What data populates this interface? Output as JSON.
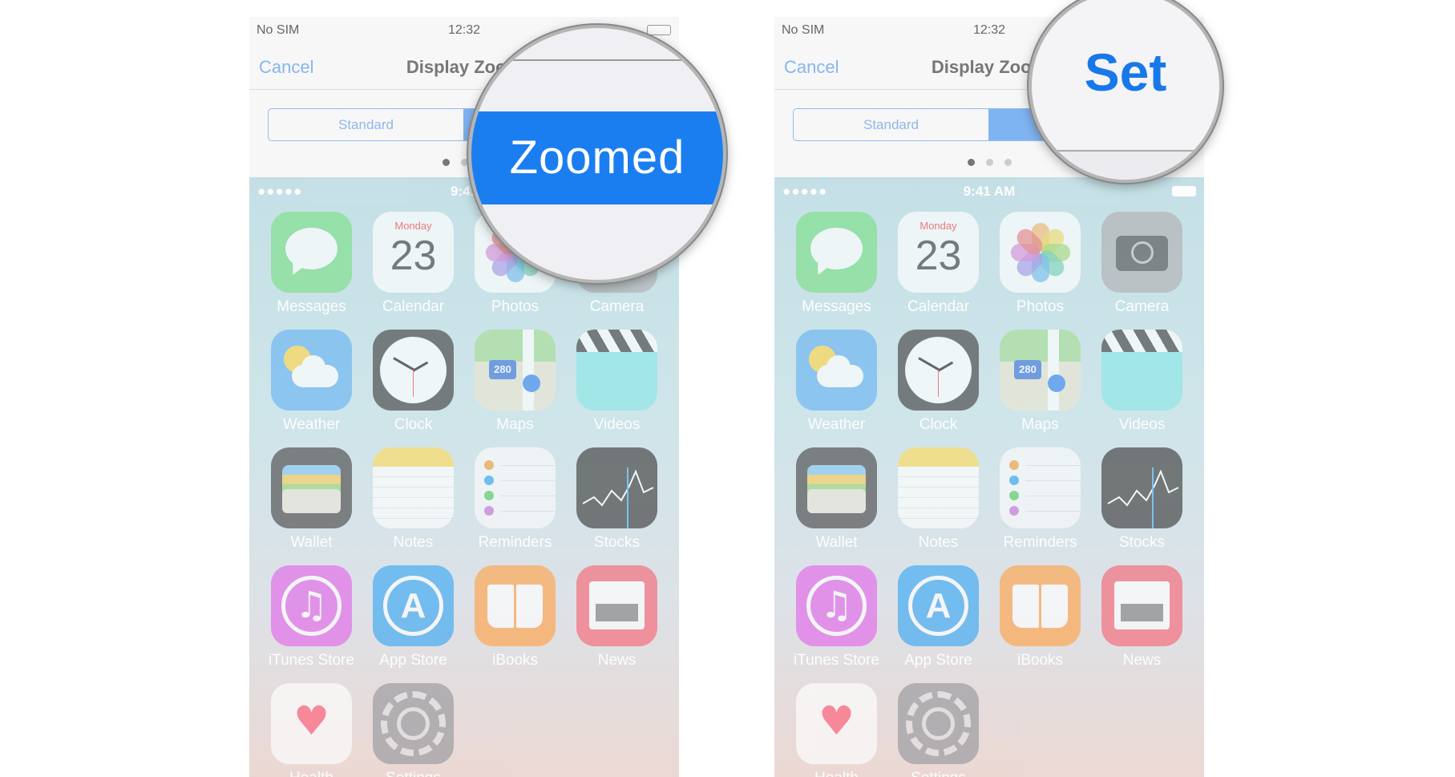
{
  "panels": [
    {
      "status": {
        "carrier": "No SIM",
        "time": "12:32"
      },
      "nav": {
        "cancel": "Cancel",
        "title": "Display Zoom"
      },
      "segment": {
        "standard": "Standard",
        "selected": "Zoomed"
      },
      "home_status": {
        "signal": "●●●●●",
        "time": "9:41"
      },
      "magnifier": {
        "text": "Zoomed"
      }
    },
    {
      "status": {
        "carrier": "No SIM",
        "time": "12:32"
      },
      "nav": {
        "cancel": "Cancel",
        "title": "Display Zoom"
      },
      "segment": {
        "standard": "Standard",
        "selected": "Zoomed"
      },
      "home_status": {
        "signal": "●●●●●",
        "time": "9:41 AM"
      },
      "magnifier": {
        "text": "Set"
      }
    }
  ],
  "calendar": {
    "day": "Monday",
    "date": "23"
  },
  "apps": [
    {
      "name": "Messages",
      "icon": "messages-icon",
      "color": "#6fdc7e"
    },
    {
      "name": "Calendar",
      "icon": "calendar-icon",
      "color": "#ffffff"
    },
    {
      "name": "Photos",
      "icon": "photos-icon",
      "color": "#ffffff"
    },
    {
      "name": "Camera",
      "icon": "camera-icon",
      "color": "#a9a9ad"
    },
    {
      "name": "Weather",
      "icon": "weather-icon",
      "color": "#5aaef2"
    },
    {
      "name": "Clock",
      "icon": "clock-icon",
      "color": "#333333"
    },
    {
      "name": "Maps",
      "icon": "maps-icon",
      "color": "#e9e4cc"
    },
    {
      "name": "Videos",
      "icon": "videos-icon",
      "color": "#7fe6e6"
    },
    {
      "name": "Wallet",
      "icon": "wallet-icon",
      "color": "#3a3a3a"
    },
    {
      "name": "Notes",
      "icon": "notes-icon",
      "color": "#fbfaf4"
    },
    {
      "name": "Reminders",
      "icon": "reminders-icon",
      "color": "#fbfbfb"
    },
    {
      "name": "Stocks",
      "icon": "stocks-icon",
      "color": "#2b2b2b"
    },
    {
      "name": "iTunes Store",
      "icon": "itunes-store-icon",
      "color": "#e05ae8"
    },
    {
      "name": "App Store",
      "icon": "app-store-icon",
      "color": "#2a9ff2"
    },
    {
      "name": "iBooks",
      "icon": "ibooks-icon",
      "color": "#ff9b3a"
    },
    {
      "name": "News",
      "icon": "news-icon",
      "color": "#f55a6a"
    },
    {
      "name": "Health",
      "icon": "health-icon",
      "color": "#ffffff"
    },
    {
      "name": "Settings",
      "icon": "settings-icon",
      "color": "#8e8e93"
    }
  ]
}
